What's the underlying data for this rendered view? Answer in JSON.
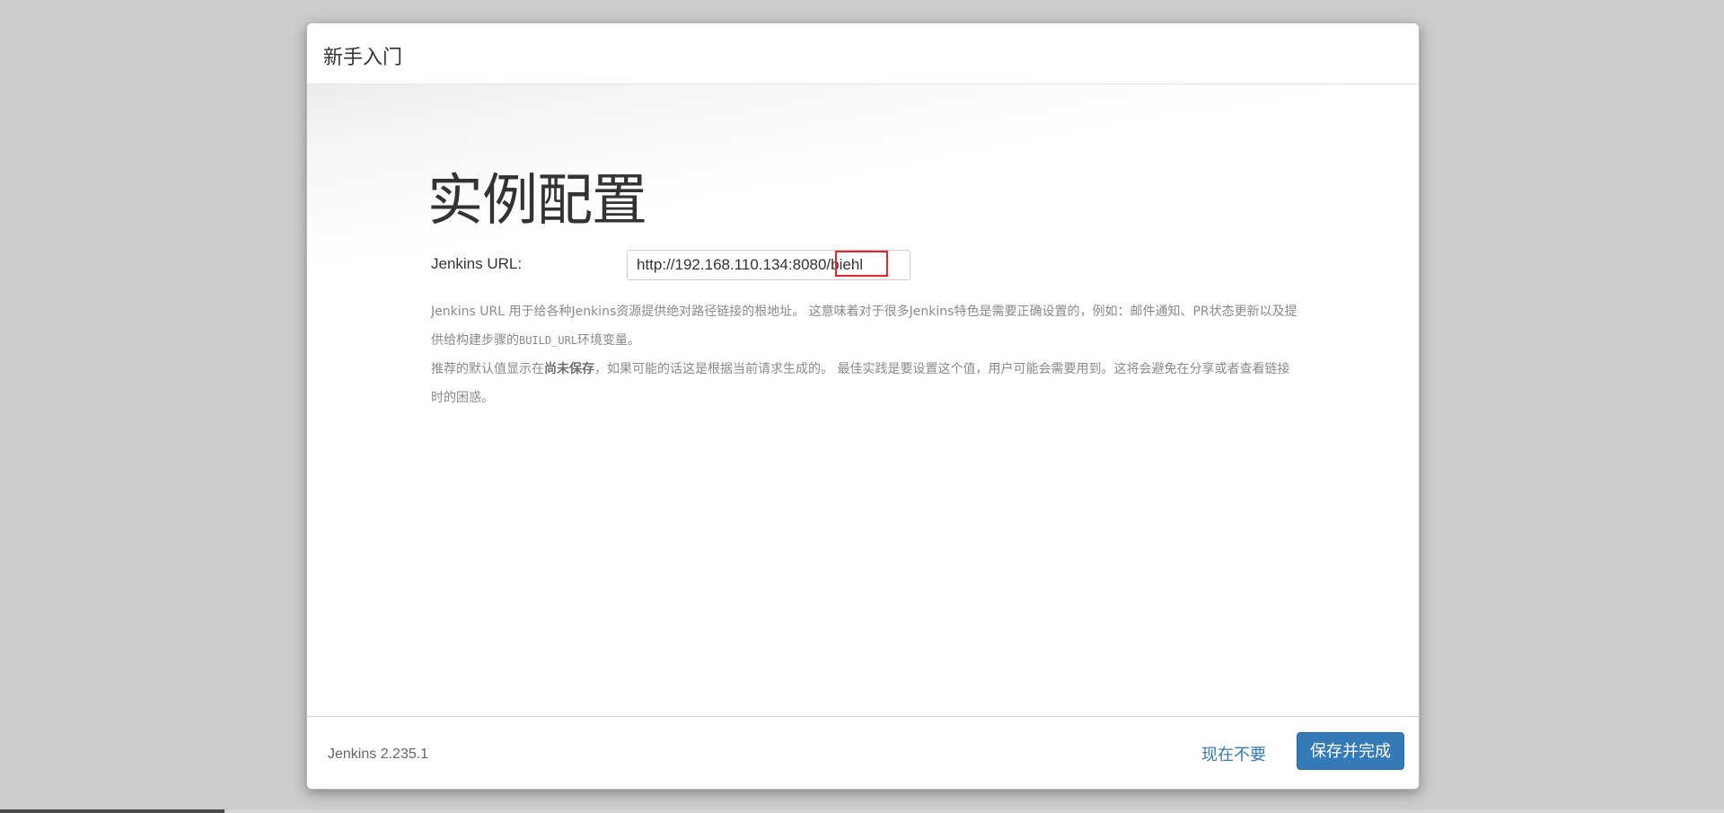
{
  "dialog": {
    "title": "新手入门"
  },
  "main": {
    "heading": "实例配置",
    "url_label": "Jenkins URL:",
    "url_value": "http://192.168.110.134:8080/biehl",
    "help": {
      "p1_a": "Jenkins URL 用于给各种Jenkins资源提供绝对路径链接的根地址。 这意味着对于很多Jenkins特色是需要正确设置的，例如：邮件通知、PR状态更新以及提供给构建步骤的",
      "p1_code": "BUILD_URL",
      "p1_b": "环境变量。",
      "p2_a": "推荐的默认值显示在",
      "p2_strong": "尚未保存",
      "p2_b": "，如果可能的话这是根据当前请求生成的。 最佳实践是要设置这个值，用户可能会需要用到。这将会避免在分享或者查看链接时的困惑。"
    }
  },
  "footer": {
    "version": "Jenkins 2.235.1",
    "skip_label": "现在不要",
    "save_label": "保存并完成"
  },
  "colors": {
    "primary": "#337ab7",
    "highlight": "#e8252b"
  }
}
